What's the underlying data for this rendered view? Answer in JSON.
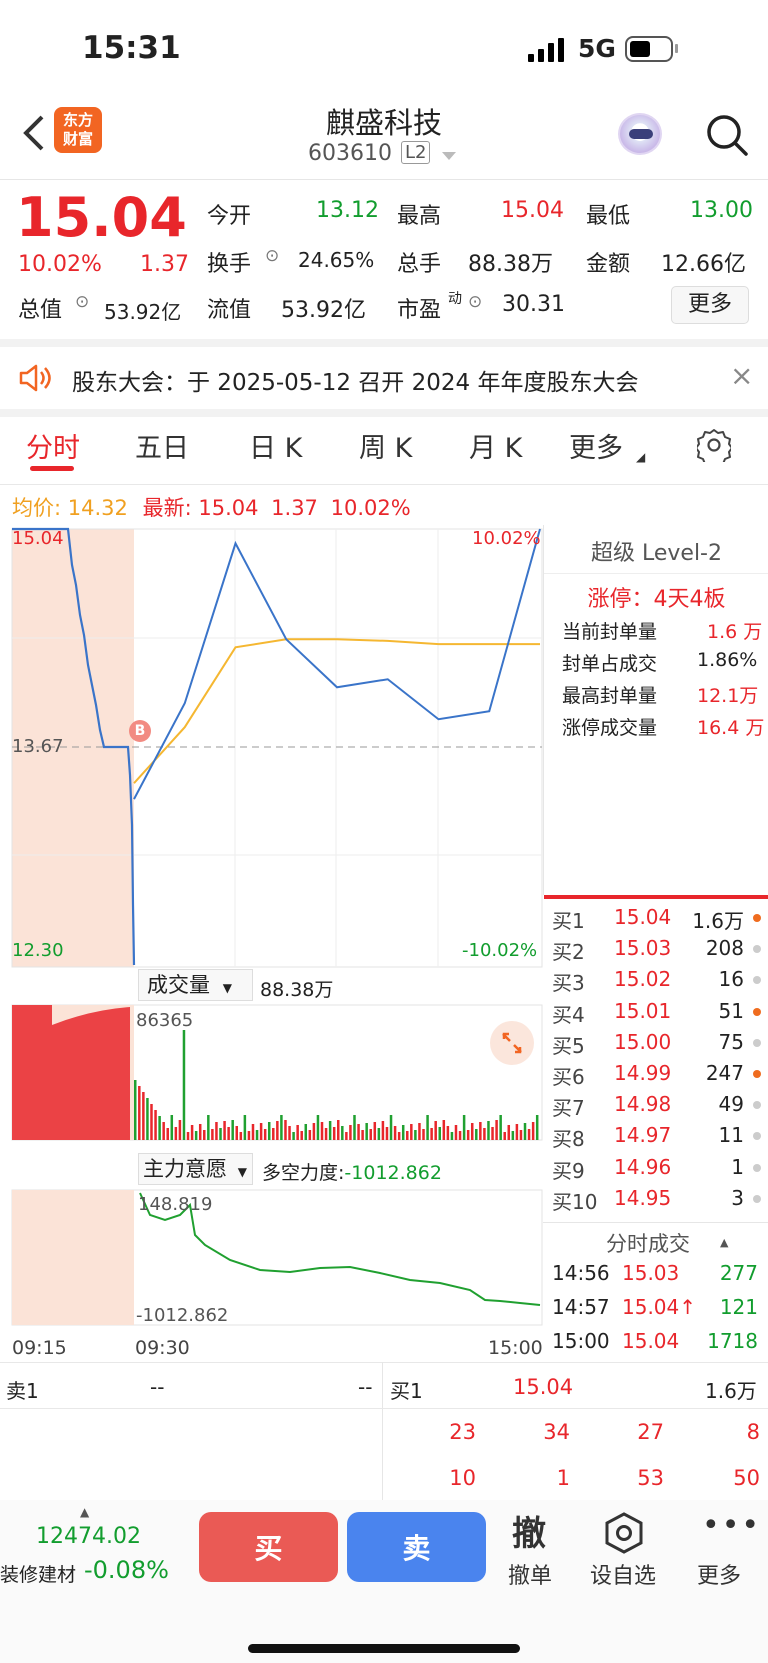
{
  "status": {
    "time": "15:31",
    "network": "5G"
  },
  "header": {
    "title": "麒盛科技",
    "code": "603610",
    "level": "L2",
    "logo_line1": "东方",
    "logo_line2": "财富"
  },
  "quote": {
    "price": "15.04",
    "change_pct": "10.02%",
    "change": "1.37",
    "open_label": "今开",
    "open": "13.12",
    "high_label": "最高",
    "high": "15.04",
    "low_label": "最低",
    "low": "13.00",
    "turnover_label": "换手",
    "turnover": "24.65%",
    "volume_label": "总手",
    "volume": "88.38万",
    "amount_label": "金额",
    "amount": "12.66亿",
    "mcap_label": "总值",
    "mcap": "53.92亿",
    "float_label": "流值",
    "float_cap": "53.92亿",
    "pe_label": "市盈",
    "pe_sup": "动",
    "pe": "30.31",
    "more_btn": "更多"
  },
  "notice": {
    "text": "股东大会：于 2025-05-12 召开 2024 年年度股东大会"
  },
  "tabs": [
    "分时",
    "五日",
    "日 K",
    "周 K",
    "月 K",
    "更多"
  ],
  "chart_info": {
    "avg_label": "均价:",
    "avg": "14.32",
    "latest_label": "最新:",
    "latest": "15.04",
    "chg": "1.37",
    "pct": "10.02%"
  },
  "chart_labels": {
    "top_price": "15.04",
    "mid_price": "13.67",
    "low_price": "12.30",
    "top_pct": "10.02%",
    "low_pct": "-10.02%",
    "b_marker": "B",
    "vol_dropdown": "成交量",
    "vol_total": "88.38万",
    "vol_max": "86365",
    "force_dropdown": "主力意愿",
    "force_label": "多空力度:",
    "force_value": "-1012.862",
    "force_max": "148.819",
    "force_min": "-1012.862",
    "t_start": "09:15",
    "t_mid": "09:30",
    "t_end": "15:00"
  },
  "chart_data": {
    "type": "line",
    "ylim": [
      12.3,
      15.04
    ],
    "prev_close": 13.67,
    "x": [
      "09:30",
      "10:00",
      "10:30",
      "11:00",
      "11:30/13:00",
      "13:30",
      "14:00",
      "14:30",
      "15:00"
    ],
    "price": [
      13.35,
      13.95,
      14.95,
      14.35,
      14.05,
      14.1,
      13.85,
      13.9,
      15.04
    ],
    "avg": [
      13.45,
      13.8,
      14.3,
      14.35,
      14.35,
      14.34,
      14.32,
      14.32,
      14.32
    ]
  },
  "level2": {
    "title": "超级 Level-2",
    "limit": "涨停：4天4板",
    "rows": [
      {
        "label": "当前封单量",
        "value": "1.6 万"
      },
      {
        "label": "封单占成交",
        "value": "1.86%"
      },
      {
        "label": "最高封单量",
        "value": "12.1万"
      },
      {
        "label": "涨停成交量",
        "value": "16.4 万"
      }
    ]
  },
  "orderbook": [
    {
      "label": "买1",
      "price": "15.04",
      "vol": "1.6万",
      "dot": "#ef6c1f"
    },
    {
      "label": "买2",
      "price": "15.03",
      "vol": "208",
      "dot": "#ccc"
    },
    {
      "label": "买3",
      "price": "15.02",
      "vol": "16",
      "dot": "#ccc"
    },
    {
      "label": "买4",
      "price": "15.01",
      "vol": "51",
      "dot": "#ef6c1f"
    },
    {
      "label": "买5",
      "price": "15.00",
      "vol": "75",
      "dot": "#ccc"
    },
    {
      "label": "买6",
      "price": "14.99",
      "vol": "247",
      "dot": "#ef6c1f"
    },
    {
      "label": "买7",
      "price": "14.98",
      "vol": "49",
      "dot": "#ccc"
    },
    {
      "label": "买8",
      "price": "14.97",
      "vol": "11",
      "dot": "#ccc"
    },
    {
      "label": "买9",
      "price": "14.96",
      "vol": "1",
      "dot": "#ccc"
    },
    {
      "label": "买10",
      "price": "14.95",
      "vol": "3",
      "dot": "#ccc"
    }
  ],
  "ticks": {
    "title": "分时成交",
    "rows": [
      {
        "t": "14:56",
        "p": "15.03",
        "v": "277"
      },
      {
        "t": "14:57",
        "p": "15.04↑",
        "v": "121"
      },
      {
        "t": "15:00",
        "p": "15.04",
        "v": "1718"
      }
    ]
  },
  "queue": {
    "sell_label": "卖1",
    "sell_price": "--",
    "sell_vol": "--",
    "buy_label": "买1",
    "buy_price": "15.04",
    "buy_vol": "1.6万",
    "row1": [
      "23",
      "34",
      "27",
      "8"
    ],
    "row2": [
      "10",
      "1",
      "53",
      "50"
    ]
  },
  "bottom": {
    "index_value": "12474.02",
    "index_name": "装修建材",
    "index_pct": "-0.08%",
    "buy": "买",
    "sell": "卖",
    "cancel": "撤单",
    "cancel_icon": "撤",
    "watch": "设自选",
    "more": "更多"
  }
}
